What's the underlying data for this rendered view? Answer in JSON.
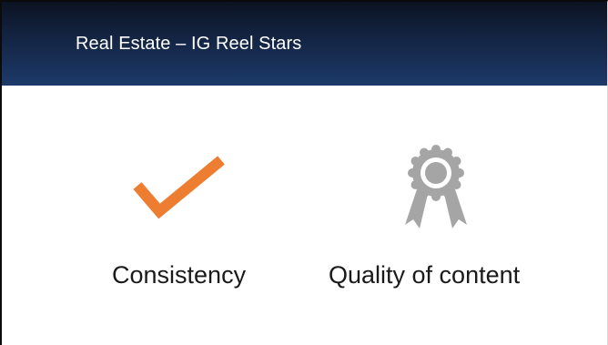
{
  "slide": {
    "title": "Real Estate – IG Reel Stars"
  },
  "items": [
    {
      "label": "Consistency",
      "icon": "checkmark-icon",
      "icon_color": "#ED7D31"
    },
    {
      "label": "Quality of content",
      "icon": "award-ribbon-icon",
      "icon_color": "#A5A5A5"
    }
  ],
  "colors": {
    "title_bar_top": "#0C1322",
    "title_bar_bottom": "#1C3A6A",
    "title_text": "#FFFFFF",
    "body_text": "#1A1A1A"
  }
}
